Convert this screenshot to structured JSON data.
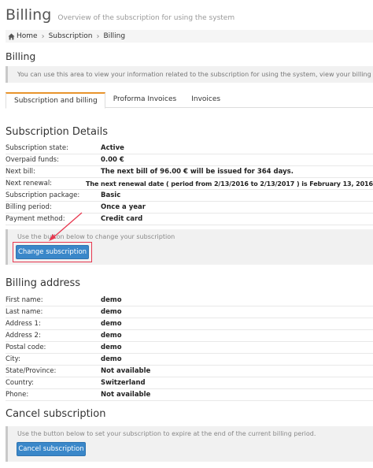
{
  "header": {
    "title": "Billing",
    "subtitle": "Overview of the subscription for using the system"
  },
  "breadcrumb": [
    "Home",
    "Subscription",
    "Billing"
  ],
  "section_title": "Billing",
  "info_text": "You can use this area to view your information related to the subscription for using the system, view your billing history, or m",
  "tabs": [
    {
      "label": "Subscription and billing",
      "active": true
    },
    {
      "label": "Proforma Invoices",
      "active": false
    },
    {
      "label": "Invoices",
      "active": false
    }
  ],
  "subscription": {
    "title": "Subscription Details",
    "rows": [
      {
        "label": "Subscription state:",
        "value": "Active"
      },
      {
        "label": "Overpaid funds:",
        "value": "0.00 €"
      },
      {
        "label": "Next bill:",
        "value": "The next bill of 96.00 € will be issued for 364 days."
      },
      {
        "label": "Next renewal:",
        "value": "The next renewal date ( period from 2/13/2016 to 2/13/2017 ) is February 13, 2016"
      },
      {
        "label": "Subscription package:",
        "value": "Basic"
      },
      {
        "label": "Billing period:",
        "value": "Once a year"
      },
      {
        "label": "Payment method:",
        "value": "Credit card"
      }
    ],
    "hint": "Use the button below to change your subscription",
    "button": "Change subscription"
  },
  "billing_address": {
    "title": "Billing address",
    "rows": [
      {
        "label": "First name:",
        "value": "demo"
      },
      {
        "label": "Last name:",
        "value": "demo"
      },
      {
        "label": "Address 1:",
        "value": "demo"
      },
      {
        "label": "Address 2:",
        "value": "demo"
      },
      {
        "label": "Postal code:",
        "value": "demo"
      },
      {
        "label": "City:",
        "value": "demo"
      },
      {
        "label": "State/Province:",
        "value": "Not available"
      },
      {
        "label": "Country:",
        "value": "Switzerland"
      },
      {
        "label": "Phone:",
        "value": "Not available"
      }
    ]
  },
  "cancel": {
    "title": "Cancel subscription",
    "hint": "Use the button below to set your subscription to expire at the end of the current billing period.",
    "button": "Cancel subscription"
  },
  "colors": {
    "accent_tab": "#e8952d",
    "button_blue": "#3a87c9",
    "annotation_red": "#e8384f"
  },
  "icons": {
    "breadcrumb_home": "home-icon"
  }
}
